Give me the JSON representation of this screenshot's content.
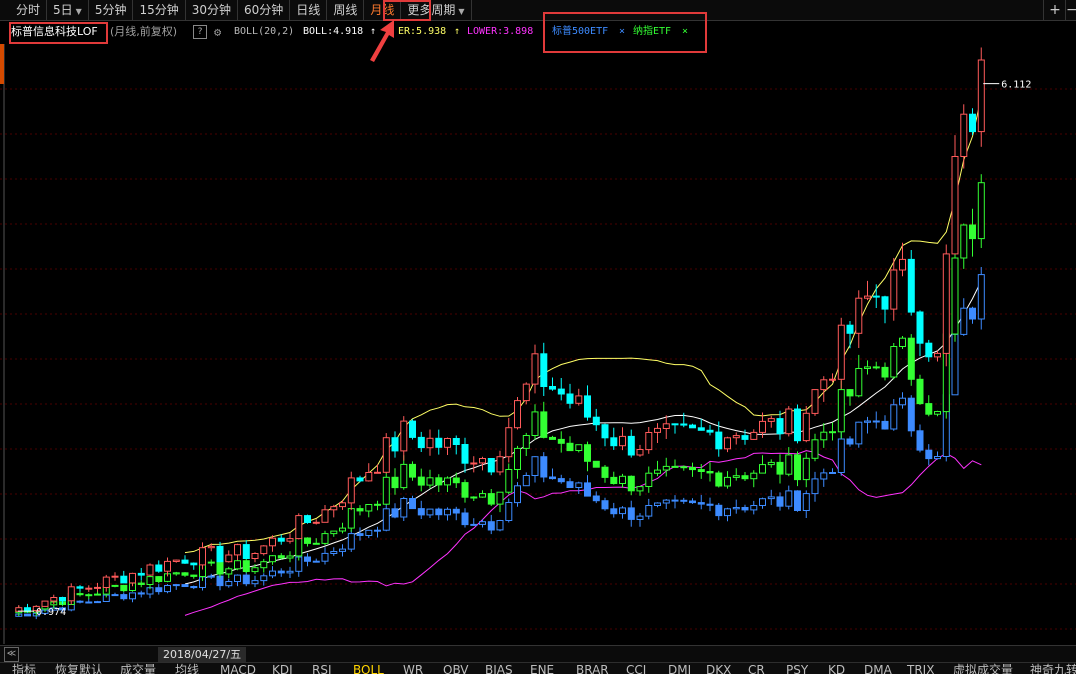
{
  "toolbar": {
    "items": [
      {
        "label": "分时",
        "caret": false
      },
      {
        "label": "5日",
        "caret": true
      },
      {
        "label": "5分钟",
        "caret": false
      },
      {
        "label": "15分钟",
        "caret": false
      },
      {
        "label": "30分钟",
        "caret": false
      },
      {
        "label": "60分钟",
        "caret": false
      },
      {
        "label": "日线",
        "caret": false
      },
      {
        "label": "周线",
        "caret": false
      },
      {
        "label": "月线",
        "caret": false
      },
      {
        "label": "更多周期",
        "caret": true
      }
    ],
    "active": "月线",
    "right_buttons": [
      {
        "icon": "plus-icon",
        "glyph": "+"
      },
      {
        "icon": "minus-icon",
        "glyph": "−"
      }
    ]
  },
  "header": {
    "security_name": "标普信息科技LOF",
    "period_note": "(月线,前复权)",
    "help_glyph": "?",
    "indicator_name": "BOLL(20,2)",
    "boll": "BOLL:4.918",
    "upper": "ER:5.938",
    "lower": "LOWER:3.898",
    "compare_items": [
      {
        "label": "标普500ETF",
        "color": "#3d8bff"
      },
      {
        "label": "纳指ETF",
        "color": "#33ff33"
      }
    ],
    "close_glyph": "×"
  },
  "chart_data": {
    "type": "candlestick",
    "title": "标普信息科技LOF",
    "period": "月线",
    "ylim": [
      0.8,
      6.4
    ],
    "max_label": "6.112",
    "min_label": "0.974",
    "crosshair_date": "2018/04/27/五",
    "colors": {
      "up": "#ff5a5a",
      "down": "#00ffff",
      "boll_mid": "#ffffff",
      "boll_upper": "#ffff66",
      "boll_lower": "#ff33ff",
      "cmp1": "#3d8bff",
      "cmp2": "#33ff33",
      "grid": "#4a0000"
    },
    "series_names": [
      "标普信息科技LOF",
      "标普500ETF",
      "纳指ETF"
    ]
  },
  "bottom_tabs": {
    "items": [
      "指标",
      "恢复默认",
      "成交量",
      "均线",
      "MACD",
      "KDJ",
      "RSI",
      "BOLL",
      "WR",
      "OBV",
      "BIAS",
      "ENE",
      "BRAR",
      "CCI",
      "DMI",
      "DKX",
      "CR",
      "PSY",
      "KD",
      "DMA",
      "TRIX",
      "虚拟成交量",
      "神奇九转"
    ],
    "active": "BOLL"
  },
  "annotation": {
    "arrow_color": "#f04040"
  }
}
